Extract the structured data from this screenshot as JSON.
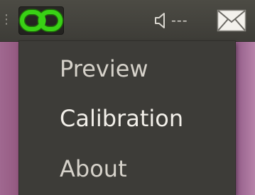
{
  "panel": {
    "grip_glyph": "⋮",
    "app_indicator": {
      "icon": "chain-link-icon",
      "color": "#39d115"
    },
    "volume": {
      "icon": "speaker-icon",
      "level_text": "---"
    },
    "mail": {
      "icon": "envelope-icon"
    }
  },
  "menu": {
    "items": [
      {
        "label": "Preview"
      },
      {
        "label": "Calibration"
      },
      {
        "label": "About"
      }
    ]
  },
  "colors": {
    "panel": "#45443f",
    "menu": "#3d3c38",
    "desktop": "#8e5a84",
    "indicator_green": "#39d115",
    "menu_text": "#d6d2ca"
  }
}
